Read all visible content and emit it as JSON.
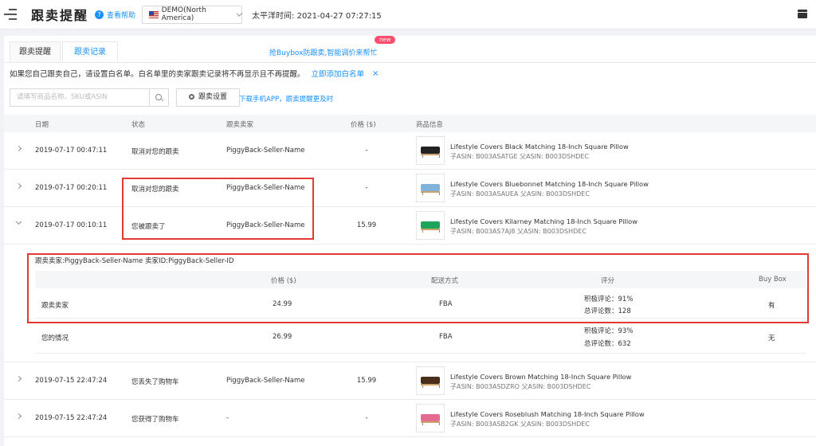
{
  "header": {
    "title": "跟卖提醒",
    "help_label": "查看帮助",
    "store": "DEMO(North America)",
    "time_label": "太平洋时间: 2021-04-27 07:27:15"
  },
  "tabs": [
    {
      "label": "跟卖提醒",
      "active": false
    },
    {
      "label": "跟卖记录",
      "active": true
    }
  ],
  "promo": {
    "text": "抢Buybox防跟卖,智能调价来帮忙",
    "badge": "new"
  },
  "notice": {
    "text": "如果您自己跟卖自己，请设置白名单。白名单里的卖家跟卖记录将不再显示且不再提醒。",
    "link": "立即添加白名单",
    "close": "×"
  },
  "toolbar": {
    "search_placeholder": "请填写商品名称、SKU或ASIN",
    "settings_label": "跟卖设置",
    "download_link": "下载手机APP，跟卖提醒更及时"
  },
  "table": {
    "headers": {
      "date": "日期",
      "status": "状态",
      "seller": "跟卖卖家",
      "price": "价格 ($)",
      "product": "商品信息"
    },
    "rows": [
      {
        "date": "2019-07-17 00:47:11",
        "status": "取消对您的跟卖",
        "seller": "PiggyBack-Seller-Name",
        "price": "-",
        "product": "Lifestyle Covers Black Matching 18-Inch Square Pillow",
        "asin": "子ASIN: B003ASATGE   父ASIN: B003DSHDEC",
        "color": "#222222",
        "expanded": false
      },
      {
        "date": "2019-07-17 00:20:11",
        "status": "取消对您的跟卖",
        "seller": "PiggyBack-Seller-Name",
        "price": "-",
        "product": "Lifestyle Covers Bluebonnet Matching 18-Inch Square Pillow",
        "asin": "子ASIN: B003ASAUEA   父ASIN: B003DSHDEC",
        "color": "#7fb3d9",
        "expanded": false
      },
      {
        "date": "2019-07-17 00:10:11",
        "status": "您被跟卖了",
        "seller": "PiggyBack-Seller-Name",
        "price": "15.99",
        "product": "Lifestyle Covers Kilarney Matching 18-Inch Square Pillow",
        "asin": "子ASIN: B003AS7AJ8   父ASIN: B003DSHDEC",
        "color": "#1fa55a",
        "expanded": true
      },
      {
        "date": "2019-07-15 22:47:24",
        "status": "您丢失了购物车",
        "seller": "PiggyBack-Seller-Name",
        "price": "15.99",
        "product": "Lifestyle Covers Brown Matching 18-Inch Square Pillow",
        "asin": "子ASIN: B003ASDZRO   父ASIN: B003DSHDEC",
        "color": "#4a2e1c",
        "expanded": false
      },
      {
        "date": "2019-07-15 22:47:24",
        "status": "您获得了购物车",
        "seller": "-",
        "price": "-",
        "product": "Lifestyle Covers Roseblush Matching 18-Inch Square Pillow",
        "asin": "子ASIN: B003ASB2GK   父ASIN: B003DSHDEC",
        "color": "#e46b8f",
        "expanded": false
      }
    ]
  },
  "detail": {
    "header": "跟卖卖家:PiggyBack-Seller-Name   卖家ID:PiggyBack-Seller-ID",
    "columns": {
      "price": "价格 ($)",
      "fulfillment": "配送方式",
      "rating": "评分",
      "buybox": "Buy Box"
    },
    "rows": [
      {
        "name": "跟卖卖家",
        "price": "24.99",
        "fulfillment": "FBA",
        "positive": "积极评论：91%",
        "total": "总评论数：128",
        "buybox": "有"
      },
      {
        "name": "您的情况",
        "price": "26.99",
        "fulfillment": "FBA",
        "positive": "积极评论：93%",
        "total": "总评论数：632",
        "buybox": "无"
      }
    ]
  },
  "colors": {
    "accent": "#1890ff",
    "highlight": "#e53935",
    "badge": "#ff4d6d"
  }
}
